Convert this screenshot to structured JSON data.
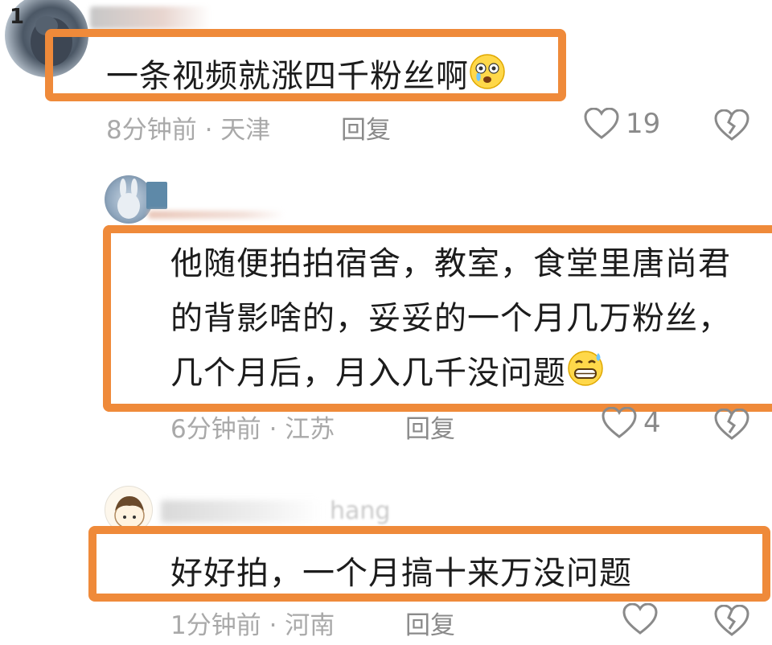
{
  "comments": [
    {
      "text": "一条视频就涨四千粉丝啊",
      "emoji": "tearful-face-emoji",
      "time_location": "8分钟前 · 天津",
      "reply_label": "回复",
      "likes": "19",
      "avatar_badge": "1"
    },
    {
      "lines": [
        "他随便拍拍宿舍，教室，食堂里唐尚君",
        "的背影啥的，妥妥的一个月几万粉丝，",
        "几个月后，月入几千没问题"
      ],
      "emoji": "grinning-sweat-emoji",
      "time_location": "6分钟前 · 江苏",
      "reply_label": "回复",
      "likes": "4"
    },
    {
      "text": "好好拍，一个月搞十来万没问题",
      "username_fragment": "hang",
      "time_location": "1分钟前 · 河南",
      "reply_label": "回复",
      "likes": ""
    }
  ],
  "colors": {
    "highlight": "#ef8a3a",
    "meta_text": "#a9a9a9",
    "icon_gray": "#8a8a8a"
  }
}
